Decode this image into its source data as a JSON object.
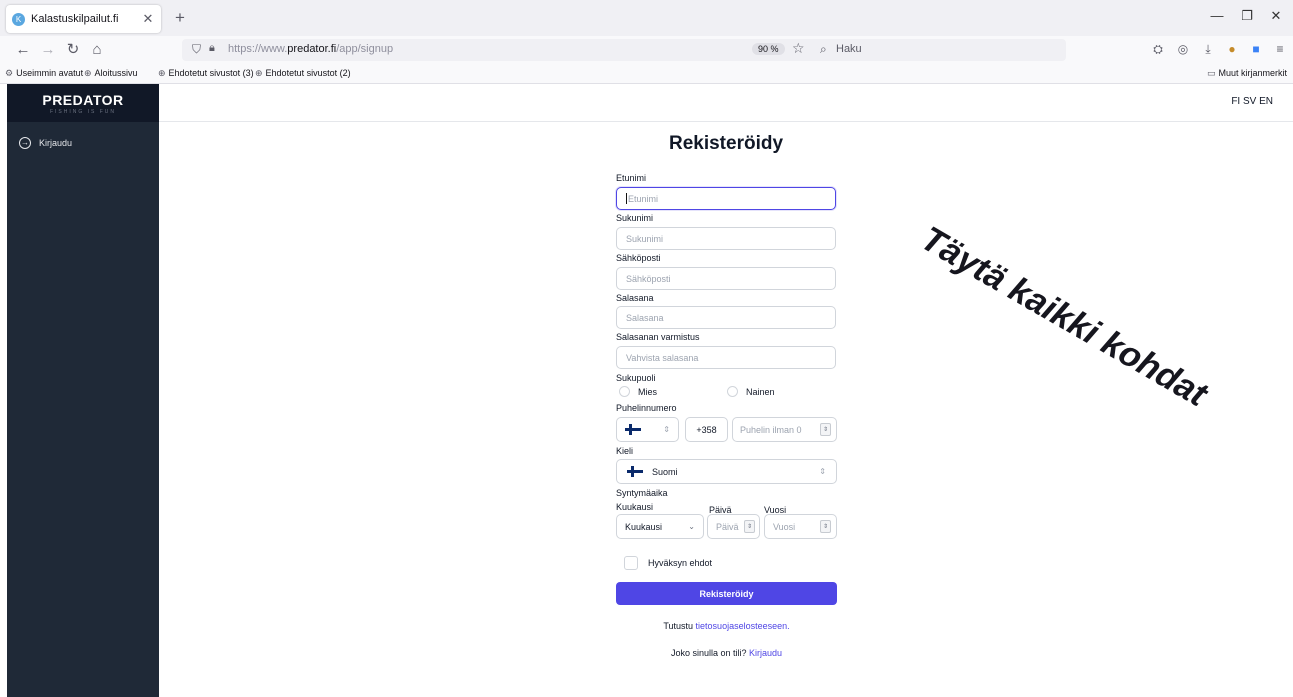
{
  "browser": {
    "tab_title": "Kalastuskilpailut.fi",
    "url_prefix": "https://www.",
    "url_domain": "predator.fi",
    "url_path": "/app/signup",
    "zoom": "90 %",
    "search_placeholder": "Haku",
    "bookmarks": [
      "Useimmin avatut",
      "Aloitussivu",
      "Ehdotetut sivustot (3)",
      "Ehdotetut sivustot (2)"
    ],
    "other_bookmarks": "Muut kirjanmerkit"
  },
  "sidebar": {
    "logo": "PREDATOR",
    "tagline": "FISHING IS FUN",
    "items": [
      {
        "label": "Kirjaudu",
        "icon": "login-icon"
      }
    ]
  },
  "header": {
    "languages": "FI SV EN"
  },
  "form": {
    "title": "Rekisteröidy",
    "first_name": {
      "label": "Etunimi",
      "placeholder": "Etunimi"
    },
    "last_name": {
      "label": "Sukunimi",
      "placeholder": "Sukunimi"
    },
    "email": {
      "label": "Sähköposti",
      "placeholder": "Sähköposti"
    },
    "password": {
      "label": "Salasana",
      "placeholder": "Salasana"
    },
    "password_confirm": {
      "label": "Salasanan varmistus",
      "placeholder": "Vahvista salasana"
    },
    "gender": {
      "label": "Sukupuoli",
      "options": [
        "Mies",
        "Nainen"
      ]
    },
    "phone": {
      "label": "Puhelinnumero",
      "country_code": "+358",
      "placeholder": "Puhelin ilman 0"
    },
    "language": {
      "label": "Kieli",
      "value": "Suomi"
    },
    "birthdate": {
      "label": "Syntymäaika",
      "month_label": "Kuukausi",
      "month_value": "Kuukausi",
      "day_label": "Päivä",
      "day_placeholder": "Päivä",
      "year_label": "Vuosi",
      "year_placeholder": "Vuosi"
    },
    "terms": "Hyväksyn ehdot",
    "submit": "Rekisteröidy",
    "privacy_prefix": "Tutustu ",
    "privacy_link": "tietosuojaselosteeseen.",
    "login_prefix": "Joko sinulla on tili? ",
    "login_link": "Kirjaudu"
  },
  "annotation": "Täytä kaikki kohdat",
  "colors": {
    "accent": "#4f46e5",
    "sidebar": "#1f2937",
    "logo_bg": "#111827"
  }
}
